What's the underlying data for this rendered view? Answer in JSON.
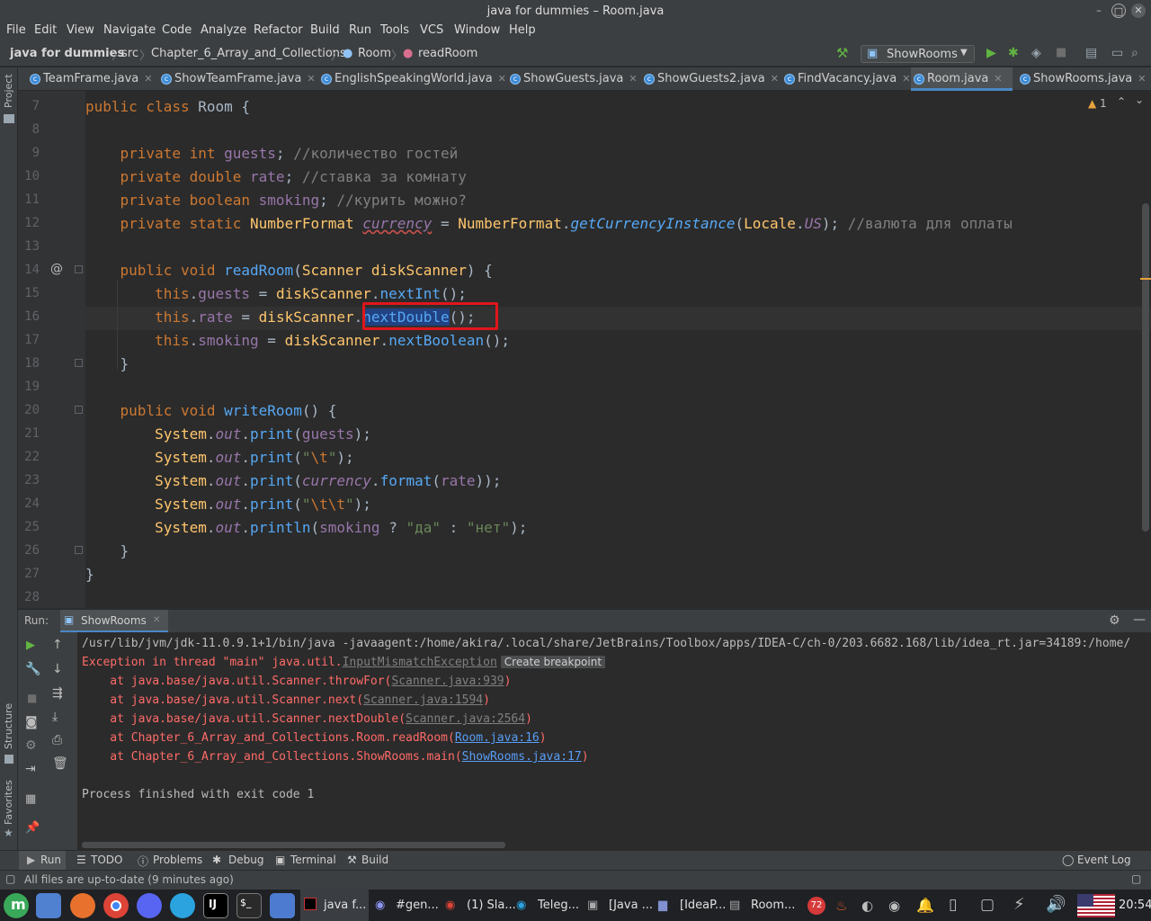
{
  "window": {
    "title": "java for dummies – Room.java"
  },
  "menu": [
    "File",
    "Edit",
    "View",
    "Navigate",
    "Code",
    "Analyze",
    "Refactor",
    "Build",
    "Run",
    "Tools",
    "VCS",
    "Window",
    "Help"
  ],
  "breadcrumb": [
    "java for dummies",
    "src",
    "Chapter_6_Array_and_Collections",
    "Room",
    "readRoom"
  ],
  "runconfig": "ShowRooms",
  "tabs": [
    "TeamFrame.java",
    "ShowTeamFrame.java",
    "EnglishSpeakingWorld.java",
    "ShowGuests.java",
    "ShowGuests2.java",
    "FindVacancy.java",
    "Room.java",
    "ShowRooms.java"
  ],
  "active_tab": "Room.java",
  "warnings": {
    "count": "1"
  },
  "sidebar": {
    "project": "Project",
    "structure": "Structure",
    "favorites": "Favorites"
  },
  "editor": {
    "line_numbers": [
      "7",
      "8",
      "9",
      "10",
      "11",
      "12",
      "13",
      "14",
      "15",
      "16",
      "17",
      "18",
      "19",
      "20",
      "21",
      "22",
      "23",
      "24",
      "25",
      "26",
      "27",
      "28"
    ],
    "comments": {
      "guests": "//количество гостей",
      "rate": "//ставка за комнату",
      "smoking": "//курить можно?",
      "currency": "//валюта для оплаты"
    },
    "strings": {
      "yes": "\"да\"",
      "no": "\"нет\""
    }
  },
  "run": {
    "label": "Run:",
    "tab": "ShowRooms",
    "lines": [
      "/usr/lib/jvm/jdk-11.0.9.1+1/bin/java -javaagent:/home/akira/.local/share/JetBrains/Toolbox/apps/IDEA-C/ch-0/203.6682.168/lib/idea_rt.jar=34189:/home/",
      "Exception in thread \"main\" java.util.",
      "InputMismatchException",
      "Create breakpoint",
      "    at java.base/java.util.Scanner.throwFor(",
      "Scanner.java:939",
      "    at java.base/java.util.Scanner.next(",
      "Scanner.java:1594",
      "    at java.base/java.util.Scanner.nextDouble(",
      "Scanner.java:2564",
      "    at Chapter_6_Array_and_Collections.Room.readRoom(",
      "Room.java:16",
      "    at Chapter_6_Array_and_Collections.ShowRooms.main(",
      "ShowRooms.java:17",
      "Process finished with exit code 1"
    ]
  },
  "bottom_tabs": [
    "Run",
    "TODO",
    "Problems",
    "Debug",
    "Terminal",
    "Build"
  ],
  "event_log": "Event Log",
  "status": "All files are up-to-date (9 minutes ago)",
  "taskbar": {
    "items": [
      "java f...",
      "#gen...",
      "(1) Sla...",
      "Teleg...",
      "[Java ...",
      "[IdeaP...",
      "Room..."
    ],
    "badge": "72",
    "clock": "20:54"
  },
  "colors": {
    "highlight_box": "#e0161b",
    "accent": "#4a88c7"
  }
}
